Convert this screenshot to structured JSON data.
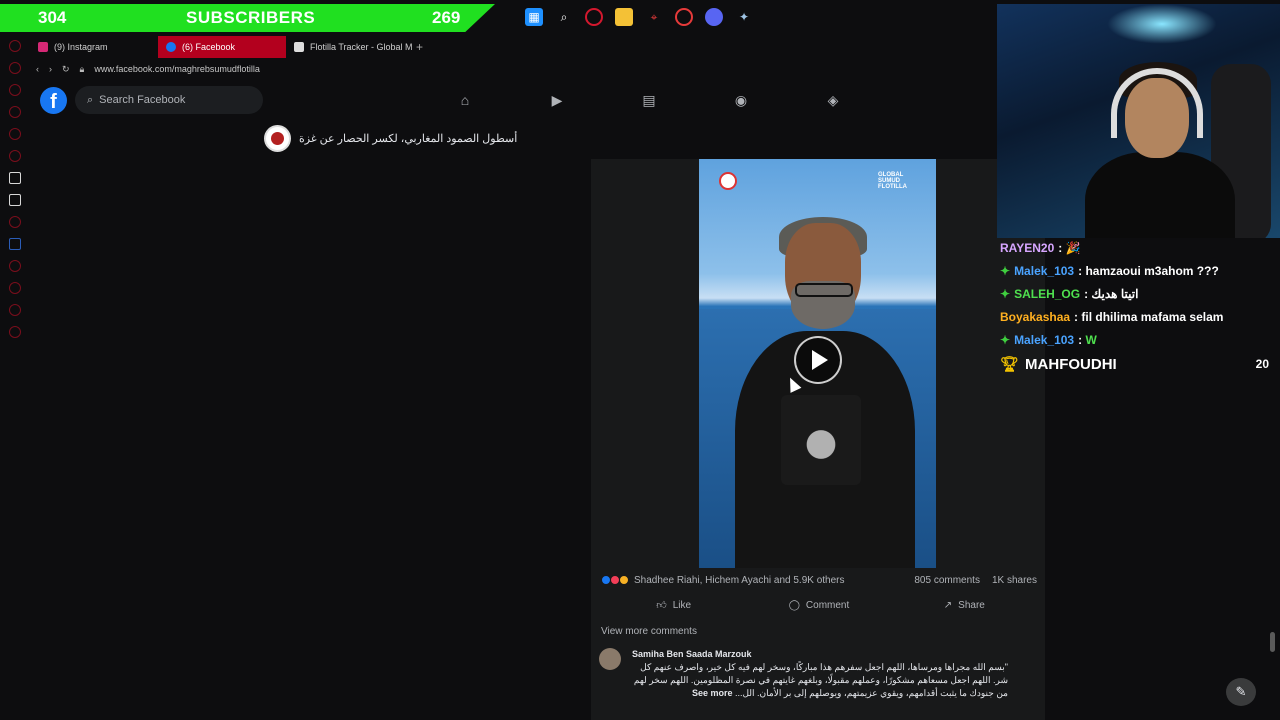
{
  "stream": {
    "subscribers_current": "304",
    "subscribers_label": "SUBSCRIBERS",
    "subscribers_goal": "269"
  },
  "taskbar": {
    "icons": [
      "windows-icon",
      "search-icon",
      "opera-icon",
      "folder-icon",
      "maps-icon",
      "clock-icon",
      "discord-icon",
      "steam-icon"
    ]
  },
  "browser": {
    "tabs": [
      {
        "label": "(9) Instagram",
        "icon": "instagram-icon",
        "active": false
      },
      {
        "label": "(6) Facebook",
        "icon": "facebook-icon",
        "active": true
      },
      {
        "label": "Flotilla Tracker - Global M",
        "icon": "flotilla-icon",
        "active": false
      }
    ],
    "new_tab": "+",
    "url": "www.facebook.com/maghrebsumudflotilla"
  },
  "facebook": {
    "search_placeholder": "Search Facebook",
    "nav": [
      "home-icon",
      "video-icon",
      "marketplace-icon",
      "groups-icon",
      "gaming-icon"
    ],
    "page_title": "أسطول الصمود المغاربي، لكسر الحصار عن غزة",
    "video_logo": "GLOBAL SUMUD FLOTILLA",
    "reactions_names": "Shadhee Riahi, Hichem Ayachi and 5.9K others",
    "comments_count": "805 comments",
    "shares_count": "1K shares",
    "actions": {
      "like": "Like",
      "comment": "Comment",
      "share": "Share"
    },
    "view_more": "View more comments",
    "comment": {
      "author": "Samiha Ben Saada Marzouk",
      "text": "\"بسم الله مجراها ومرساها، اللهم اجعل سفرهم هذا مباركًا، وسخر لهم فيه كل خير، واصرف عنهم كل شر. اللهم اجعل مسعاهم مشكورًا، وعملهم مقبولًا، وبلغهم غايتهم في نصرة المظلومين. اللهم سخر لهم من جنودك ما يثبت أقدامهم، ويقوي عزيمتهم، ويوصلهم إلى بر الأمان. الل...",
      "see_more": "See more"
    }
  },
  "chat": [
    {
      "user": "RAYEN20",
      "message": "🎉",
      "user_color": "#d7a6ff",
      "badge": false
    },
    {
      "user": "Malek_103",
      "message": "hamzaoui m3ahom ???",
      "user_color": "#4aa3ff",
      "badge": true
    },
    {
      "user": "SALEH_OG",
      "message": "اتيتا هديك",
      "user_color": "#4fe04f",
      "badge": true
    },
    {
      "user": "Boyakashaa",
      "message": "fil dhilima mafama selam",
      "user_color": "#ffb020",
      "badge": false
    },
    {
      "user": "Malek_103",
      "message": "W",
      "user_color": "#4aa3ff",
      "badge": true
    }
  ],
  "chat_highlight": {
    "user": "MAHFOUDHI",
    "count": "20"
  },
  "colors": {
    "banner_green": "#20e020",
    "facebook_blue": "#1877f2",
    "active_tab": "#b3001e"
  }
}
